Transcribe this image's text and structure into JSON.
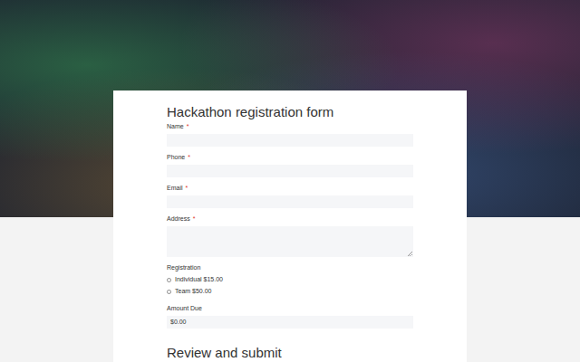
{
  "form": {
    "title": "Hackathon registration form",
    "required_mark": "*",
    "fields": [
      {
        "label": "Name",
        "required": true,
        "kind": "text",
        "value": ""
      },
      {
        "label": "Phone",
        "required": true,
        "kind": "text",
        "value": ""
      },
      {
        "label": "Email",
        "required": true,
        "kind": "text",
        "value": ""
      },
      {
        "label": "Address",
        "required": true,
        "kind": "textarea",
        "value": ""
      }
    ],
    "registration": {
      "label": "Registration",
      "options": [
        {
          "label": "Individual $15.00",
          "selected": false
        },
        {
          "label": "Team $50.00",
          "selected": false
        }
      ]
    },
    "amount_due": {
      "label": "Amount Due",
      "value": "$0.00"
    },
    "section_title": "Review and submit"
  }
}
